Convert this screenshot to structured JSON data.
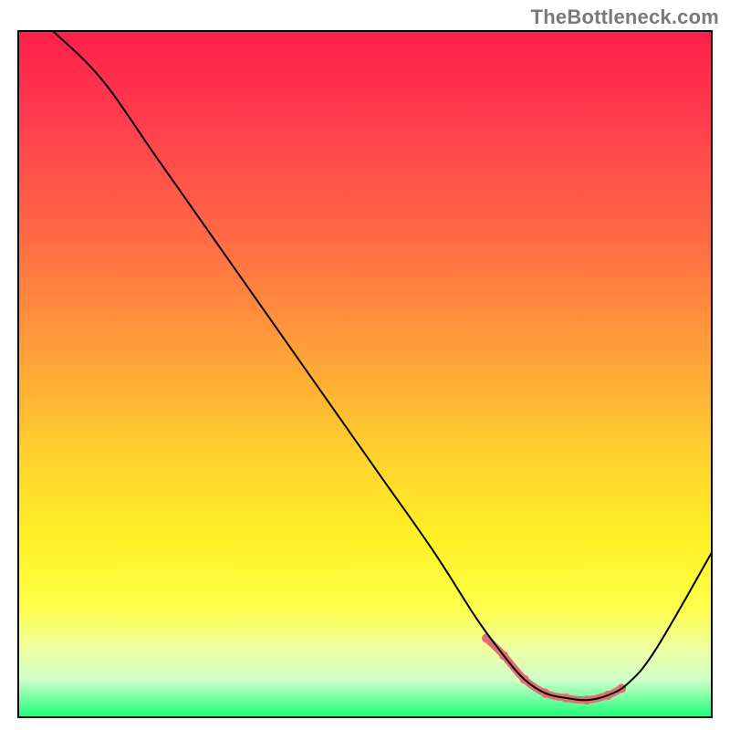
{
  "watermark": "TheBottleneck.com",
  "chart_data": {
    "type": "line",
    "title": "",
    "xlabel": "",
    "ylabel": "",
    "xlim": [
      0,
      100
    ],
    "ylim": [
      0,
      100
    ],
    "grid": false,
    "legend": false,
    "background_gradient_stops": [
      {
        "offset": 0.0,
        "color": "#ff1f4b"
      },
      {
        "offset": 0.12,
        "color": "#ff3b4d"
      },
      {
        "offset": 0.3,
        "color": "#ff6a45"
      },
      {
        "offset": 0.48,
        "color": "#ffa438"
      },
      {
        "offset": 0.62,
        "color": "#ffd22e"
      },
      {
        "offset": 0.74,
        "color": "#fff126"
      },
      {
        "offset": 0.84,
        "color": "#fdff4a"
      },
      {
        "offset": 0.9,
        "color": "#efffa0"
      },
      {
        "offset": 0.945,
        "color": "#cfffc8"
      },
      {
        "offset": 0.975,
        "color": "#6fff9e"
      },
      {
        "offset": 1.0,
        "color": "#1aff79"
      }
    ],
    "series": [
      {
        "name": "curve",
        "stroke": "#000000",
        "stroke_width": 2,
        "x": [
          5,
          12,
          20,
          28,
          36,
          44,
          52,
          60,
          66,
          70,
          73,
          76,
          79,
          82,
          85,
          88,
          92,
          100
        ],
        "y": [
          100,
          93,
          81.5,
          70,
          58.5,
          47,
          35.5,
          24,
          14.5,
          9,
          5.5,
          3.5,
          2.8,
          2.5,
          3.2,
          5,
          10,
          24
        ]
      },
      {
        "name": "valley-highlight",
        "stroke": "#e06e73",
        "stroke_width": 8,
        "x": [
          67.5,
          70,
          73,
          76,
          79,
          82,
          85,
          87
        ],
        "y": [
          11.5,
          9,
          5.5,
          3.5,
          2.8,
          2.5,
          3.2,
          4.2
        ]
      }
    ]
  }
}
